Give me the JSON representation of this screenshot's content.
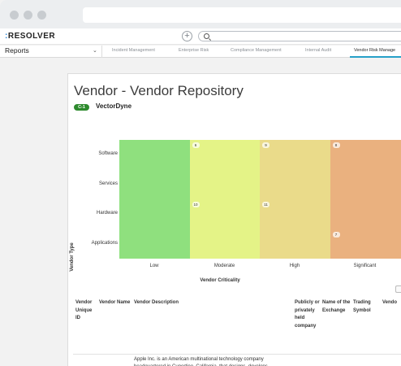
{
  "browser": {},
  "app": {
    "logo_colon": ":",
    "logo_text": "RESOLVER"
  },
  "nav": {
    "reports_label": "Reports",
    "tabs": [
      {
        "label": "Incident Management"
      },
      {
        "label": "Enterprise Risk"
      },
      {
        "label": "Compliance Management"
      },
      {
        "label": "Internal Audit"
      },
      {
        "label": "Vendor Risk Manage"
      }
    ]
  },
  "report": {
    "title": "Vendor - Vendor Repository",
    "badge": "C-1",
    "vendor_name": "VectorDyne"
  },
  "chart_data": {
    "type": "heatmap",
    "xlabel": "Vendor Criticality",
    "ylabel": "Vendor Type",
    "columns": [
      "Low",
      "Moderate",
      "High",
      "Significant"
    ],
    "rows": [
      "Software",
      "Services",
      "Hardware",
      "Applications"
    ],
    "column_colors": [
      "#8fe07e",
      "#e4f387",
      "#eadb8a",
      "#eab17f"
    ],
    "counts": [
      {
        "row": "Software",
        "column": "Moderate",
        "value": 6
      },
      {
        "row": "Software",
        "column": "High",
        "value": 9
      },
      {
        "row": "Software",
        "column": "Significant",
        "value": 8
      },
      {
        "row": "Hardware",
        "column": "Moderate",
        "value": 10
      },
      {
        "row": "Hardware",
        "column": "High",
        "value": 11
      },
      {
        "row": "Applications",
        "column": "Significant",
        "value": 7
      }
    ]
  },
  "table": {
    "headers": [
      "Vendor Unique ID",
      "Vendor Name",
      "Vendor Description",
      "Publicly or privately held company",
      "Name of the Exchange",
      "Trading Symbol",
      "Vendo"
    ],
    "first_row_description": "Apple Inc. is an American multinational technology company headquartered in Cupertino, California, that designs, develops"
  }
}
